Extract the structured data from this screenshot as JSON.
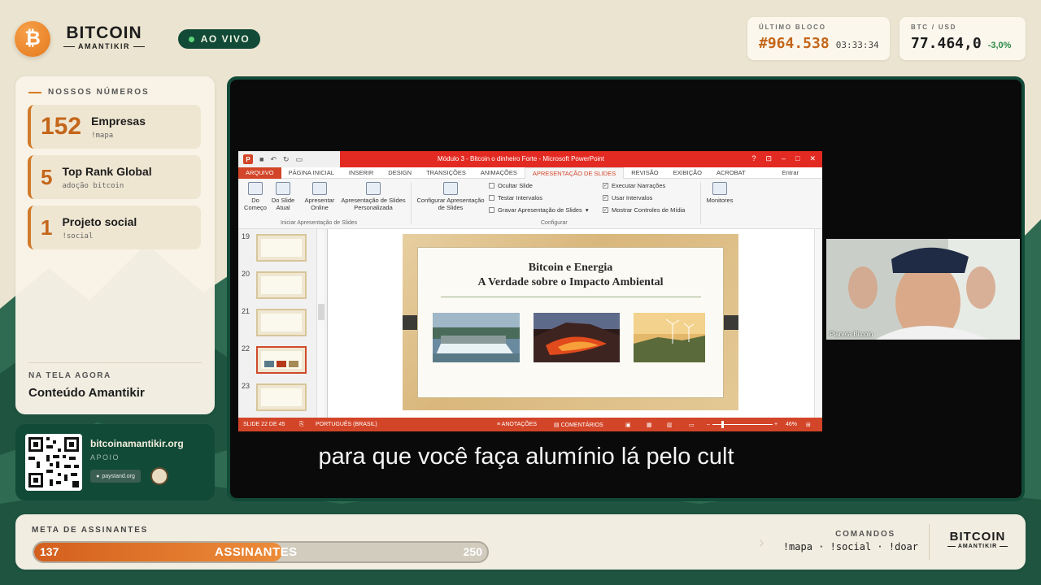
{
  "header": {
    "logo_symbol": "₿",
    "brand_name": "BITCOIN",
    "brand_sub": "AMANTIKIR",
    "live_label": "AO VIVO",
    "last_block": {
      "label": "ÚLTIMO BLOCO",
      "value": "#964.538",
      "time": "03:33:34"
    },
    "btc_usd": {
      "label": "BTC / USD",
      "value": "77.464,0",
      "change": "-3,0%"
    }
  },
  "numbers": {
    "title": "NOSSOS NÚMEROS",
    "items": [
      {
        "number": "152",
        "title": "Empresas",
        "command": "!mapa"
      },
      {
        "number": "5",
        "title": "Top Rank Global",
        "command": "adoção bitcoin"
      },
      {
        "number": "1",
        "title": "Projeto social",
        "command": "!social"
      }
    ],
    "now_label": "NA TELA AGORA",
    "now_title": "Conteúdo Amantikir"
  },
  "support": {
    "site": "bitcoinamantikir.org",
    "apoio_label": "APOIO",
    "partner1": "paystand.org"
  },
  "powerpoint": {
    "window_title": "Módulo 3 - Bitcoin o dinheiro Forte - Microsoft PowerPoint",
    "window_buttons": [
      "?",
      "⊡",
      "–",
      "□",
      "✕"
    ],
    "menu": [
      "ARQUIVO",
      "PÁGINA INICIAL",
      "INSERIR",
      "DESIGN",
      "TRANSIÇÕES",
      "ANIMAÇÕES",
      "APRESENTAÇÃO DE SLIDES",
      "REVISÃO",
      "EXIBIÇÃO",
      "ACROBAT"
    ],
    "signin": "Entrar",
    "ribbon": {
      "from_start": "Do Começo",
      "from_current": "Do Slide Atual",
      "present_online": "Apresentar Online",
      "custom_show": "Apresentação de Slides Personalizada",
      "group1": "Iniciar Apresentação de Slides",
      "setup": "Configurar Apresentação de Slides",
      "hide_slide": "Ocultar Slide",
      "rehearse": "Testar Intervalos",
      "record": "Gravar Apresentação de Slides",
      "play_narrations": "Executar Narrações",
      "use_timings": "Usar Intervalos",
      "show_media": "Mostrar Controles de Mídia",
      "group2": "Configurar",
      "monitors": "Monitores"
    },
    "thumbnails": [
      "19",
      "20",
      "21",
      "22",
      "23"
    ],
    "slide": {
      "title_line1": "Bitcoin e Energia",
      "title_line2": "A Verdade sobre o Impacto Ambiental"
    },
    "status": {
      "slide_counter": "SLIDE 22 DE 45",
      "language": "PORTUGUÊS (BRASIL)",
      "notes": "ANOTAÇÕES",
      "comments": "COMENTÁRIOS",
      "zoom": "46%"
    }
  },
  "webcam": {
    "name": "Planeta Bitcoin"
  },
  "subtitle": "para que você faça alumínio lá pelo cult",
  "goal": {
    "label": "META DE ASSINANTES",
    "current": "137",
    "center_label": "ASSINANTES",
    "goal": "250",
    "progress_fraction": 0.548
  },
  "commands": {
    "label": "COMANDOS",
    "list": "!mapa · !social · !doar"
  },
  "colors": {
    "accent": "#d07a2b",
    "green": "#124a38",
    "ppt_red": "#d34528"
  }
}
